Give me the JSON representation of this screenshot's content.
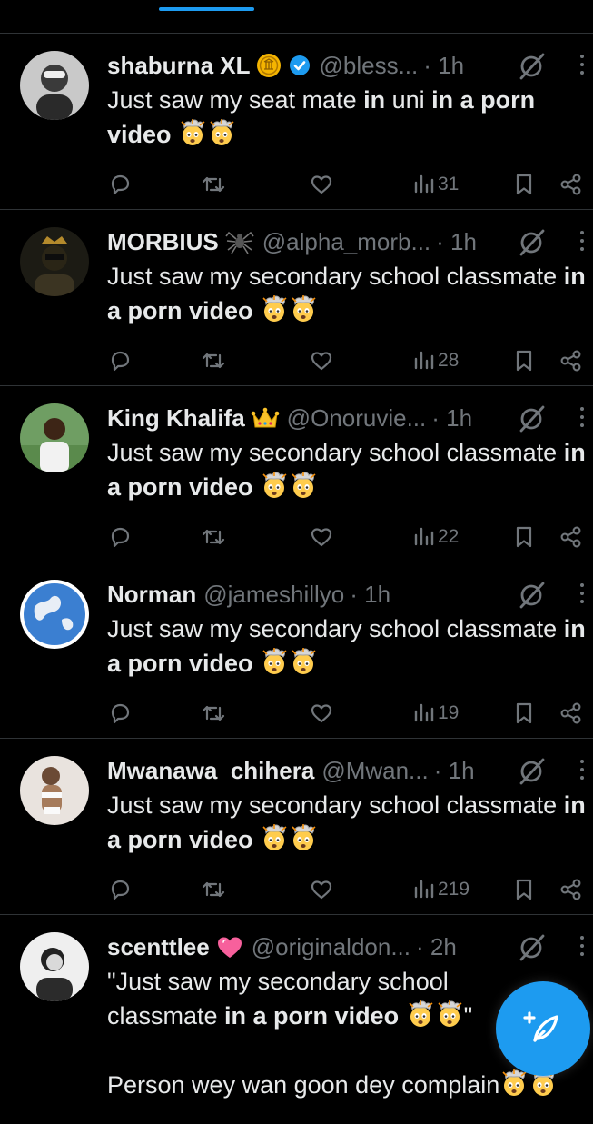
{
  "colors": {
    "accent": "#1d9bf0",
    "background": "#000000",
    "text": "#e7e9ea",
    "muted": "#71767b",
    "divider": "#2f3336"
  },
  "tweets": [
    {
      "name": "shaburna XL",
      "name_emoji": "coin-badge",
      "verified": true,
      "handle": "@bless...",
      "time": "· 1h",
      "text_parts": [
        {
          "t": "Just saw my seat mate ",
          "b": false
        },
        {
          "t": "in",
          "b": true
        },
        {
          "t": " uni ",
          "b": false
        },
        {
          "t": "in a porn video",
          "b": true
        },
        {
          "t": " ",
          "b": false
        }
      ],
      "views": "31"
    },
    {
      "name": "MORBIUS",
      "name_emoji": "spider-emoji",
      "verified": false,
      "handle": "@alpha_morb...",
      "time": "· 1h",
      "text_parts": [
        {
          "t": "Just saw my secondary school classmate ",
          "b": false
        },
        {
          "t": "in a porn video",
          "b": true
        },
        {
          "t": " ",
          "b": false
        }
      ],
      "views": "28"
    },
    {
      "name": "King Khalifa",
      "name_emoji": "crown-emoji",
      "verified": false,
      "handle": "@Onoruvie...",
      "time": "· 1h",
      "text_parts": [
        {
          "t": "Just saw my secondary school classmate ",
          "b": false
        },
        {
          "t": "in a porn video",
          "b": true
        },
        {
          "t": " ",
          "b": false
        }
      ],
      "views": "22"
    },
    {
      "name": "Norman",
      "name_emoji": "",
      "verified": false,
      "handle": "@jameshillyo",
      "time": "· 1h",
      "text_parts": [
        {
          "t": "Just saw my secondary school classmate ",
          "b": false
        },
        {
          "t": "in a porn video",
          "b": true
        },
        {
          "t": " ",
          "b": false
        }
      ],
      "views": "19"
    },
    {
      "name": "Mwanawa_chihera",
      "name_emoji": "",
      "verified": false,
      "handle": "@Mwan...",
      "time": "· 1h",
      "text_parts": [
        {
          "t": "Just saw my secondary school classmate ",
          "b": false
        },
        {
          "t": "in a porn video",
          "b": true
        },
        {
          "t": " ",
          "b": false
        }
      ],
      "views": "219"
    },
    {
      "name": "scenttlee",
      "name_emoji": "heart-emoji",
      "verified": false,
      "handle": "@originaldon...",
      "time": "· 2h",
      "text_parts": [
        {
          "t": "\"Just saw my secondary school\nclassmate ",
          "b": false
        },
        {
          "t": "in a porn video",
          "b": true
        },
        {
          "t": " ",
          "b": false
        },
        {
          "t": "\"\n\nPerson wey wan goon dey complain",
          "b": false
        }
      ],
      "views": ""
    }
  ],
  "emoji_after_text": "exploding-head-emoji"
}
